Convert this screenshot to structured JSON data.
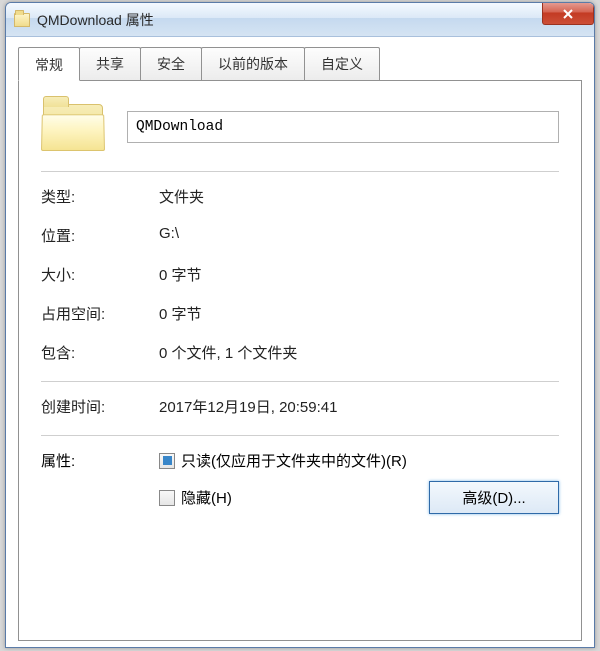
{
  "titlebar": {
    "title": "QMDownload 属性"
  },
  "tabs": {
    "general": "常规",
    "sharing": "共享",
    "security": "安全",
    "previous": "以前的版本",
    "customize": "自定义"
  },
  "folder": {
    "name": "QMDownload"
  },
  "info": {
    "type_label": "类型:",
    "type_value": "文件夹",
    "location_label": "位置:",
    "location_value": "G:\\",
    "size_label": "大小:",
    "size_value": "0 字节",
    "disk_label": "占用空间:",
    "disk_value": "0 字节",
    "contains_label": "包含:",
    "contains_value": "0 个文件, 1 个文件夹",
    "created_label": "创建时间:",
    "created_value": "2017年12月19日, 20:59:41"
  },
  "attributes": {
    "label": "属性:",
    "readonly": "只读(仅应用于文件夹中的文件)(R)",
    "hidden": "隐藏(H)",
    "advanced": "高级(D)..."
  }
}
